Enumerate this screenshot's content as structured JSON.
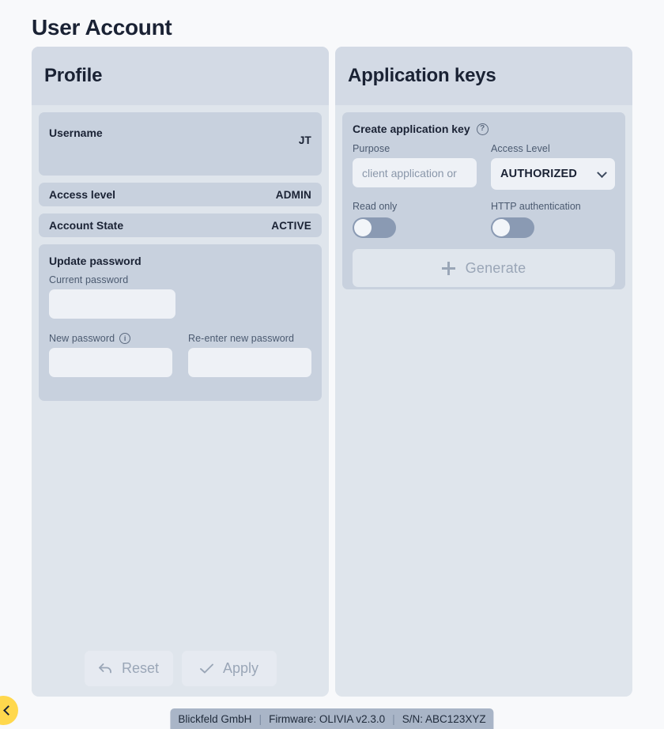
{
  "page": {
    "title": "User Account"
  },
  "profile": {
    "header": "Profile",
    "rows": [
      {
        "label": "Username",
        "value": "JT"
      },
      {
        "label": "Access level",
        "value": "ADMIN"
      },
      {
        "label": "Account State",
        "value": "ACTIVE"
      }
    ],
    "password": {
      "title": "Update password",
      "current_label": "Current password",
      "current_value": "",
      "current_placeholder": "",
      "new_label": "New password",
      "new_info_icon": "info-icon",
      "new_value": "",
      "new_placeholder": "",
      "reenter_label": "Re-enter new password",
      "reenter_value": "",
      "reenter_placeholder": ""
    }
  },
  "appkeys": {
    "header": "Application keys",
    "create": {
      "title": "Create application key",
      "help_icon": "help-icon",
      "purpose_label": "Purpose",
      "purpose_value": "",
      "purpose_placeholder": "client application or",
      "access_level_label": "Access Level",
      "access_level_value": "AUTHORIZED",
      "access_level_options": [
        "AUTHORIZED"
      ],
      "chevron_icon": "chevron-down-icon",
      "read_only_label": "Read only",
      "read_only_state": "off",
      "http_auth_label": "HTTP authentication",
      "http_auth_state": "off",
      "generate_label": "Generate",
      "generate_icon": "plus-icon"
    }
  },
  "actions": {
    "reset_label": "Reset",
    "reset_icon": "undo-arrow-icon",
    "apply_label": "Apply",
    "apply_icon": "check-icon"
  },
  "status_bar": {
    "company": "Blickfeld GmbH",
    "sep1": "|",
    "firmware": "Firmware: OLIVIA v2.3.0",
    "sep2": "|",
    "serial": "S/N: ABC123XYZ"
  },
  "side_handle": {
    "icon": "chevron-left-icon"
  },
  "colors": {
    "page_bg": "#f8f9fb",
    "card_bg": "#dfe5ec",
    "card_header_bg": "#d3dae5",
    "row_bg": "#c8d1de",
    "input_bg": "#eef1f6",
    "toggle_track": "#8a9ab3",
    "accent_yellow": "#ffd84d",
    "status_bar_bg": "#a9b5c7",
    "text_dark": "#1a2234",
    "text_muted": "#9aa6b7"
  }
}
